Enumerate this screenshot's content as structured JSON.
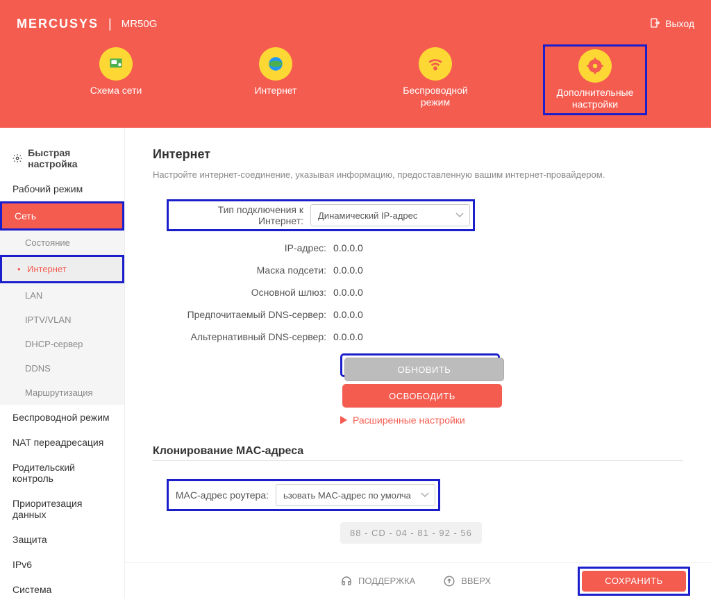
{
  "brand": "MERCUSYS",
  "model": "MR50G",
  "logout": "Выход",
  "nav": {
    "map": "Схема сети",
    "internet": "Интернет",
    "wireless": "Беспроводной режим",
    "advanced": "Дополнительные настройки"
  },
  "sidebar": {
    "quick": "Быстрая настройка",
    "mode": "Рабочий режим",
    "network": "Сеть",
    "sub": {
      "status": "Состояние",
      "internet": "Интернет",
      "lan": "LAN",
      "iptv": "IPTV/VLAN",
      "dhcp": "DHCP-сервер",
      "ddns": "DDNS",
      "routing": "Маршрутизация"
    },
    "wireless": "Беспроводной режим",
    "nat": "NAT переадресация",
    "parental": "Родительский контроль",
    "qos": "Приоритезация данных",
    "security": "Защита",
    "ipv6": "IPv6",
    "system": "Система"
  },
  "page": {
    "title": "Интернет",
    "desc": "Настройте интернет-соединение, указывая информацию, предоставленную вашим интернет-провайдером.",
    "conn_type_label": "Тип подключения к Интернет:",
    "conn_type_val": "Динамический IP-адрес",
    "ip_label": "IP-адрес:",
    "ip_val": "0.0.0.0",
    "mask_label": "Маска подсети:",
    "mask_val": "0.0.0.0",
    "gw_label": "Основной шлюз:",
    "gw_val": "0.0.0.0",
    "dns1_label": "Предпочитаемый DNS-сервер:",
    "dns1_val": "0.0.0.0",
    "dns2_label": "Альтернативный DNS-сервер:",
    "dns2_val": "0.0.0.0",
    "btn_renew": "ОБНОВИТЬ",
    "btn_release": "ОСВОБОДИТЬ",
    "adv_link": "Расширенные настройки",
    "mac_section": "Клонирование MAC-адреса",
    "mac_label": "MAC-адрес роутера:",
    "mac_sel": "ьзовать MAC-адрес по умолча",
    "mac_val": "88  -  CD  -  04  -  81  -  92  -  56"
  },
  "footer": {
    "support": "ПОДДЕРЖКА",
    "top": "ВВЕРХ",
    "save": "СОХРАНИТЬ"
  }
}
